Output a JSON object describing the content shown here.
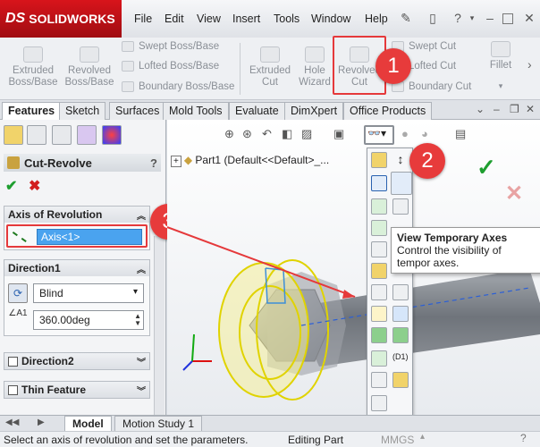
{
  "app": {
    "logo_ds": "DS",
    "logo_text": "SOLIDWORKS"
  },
  "menu": [
    "File",
    "Edit",
    "View",
    "Insert",
    "Tools",
    "Window",
    "Help"
  ],
  "ribbon": {
    "extruded_boss": "Extruded\nBoss/Base",
    "revolved_boss": "Revolved\nBoss/Base",
    "swept_boss": "Swept Boss/Base",
    "lofted_boss": "Lofted Boss/Base",
    "boundary_boss": "Boundary Boss/Base",
    "extruded_cut": "Extruded\nCut",
    "hole_wizard": "Hole\nWizard",
    "revolved_cut": "Revolved\nCut",
    "swept_cut": "Swept Cut",
    "lofted_cut": "Lofted Cut",
    "boundary_cut": "Boundary Cut",
    "fillet": "Fillet"
  },
  "tabs": [
    "Features",
    "Sketch",
    "Surfaces",
    "Mold Tools",
    "Evaluate",
    "DimXpert",
    "Office Products"
  ],
  "property_manager": {
    "title": "Cut-Revolve",
    "help": "?",
    "axis_group": "Axis of Revolution",
    "axis_value": "Axis<1>",
    "direction1": "Direction1",
    "type_value": "Blind",
    "angle_value": "360.00deg",
    "direction2": "Direction2",
    "thin_feature": "Thin Feature"
  },
  "viewport": {
    "tree_label": "Part1  (Default<<Default>_..."
  },
  "tooltip": {
    "title": "View Temporary Axes",
    "desc": "Control the visibility of tempor axes."
  },
  "palette": {
    "d1_label": "(D1)"
  },
  "bottom_tabs": [
    "Model",
    "Motion Study 1"
  ],
  "status": {
    "left": "Select an axis of revolution and set the parameters.",
    "middle": "Editing Part",
    "right": "MMGS"
  },
  "callouts": [
    "1",
    "2",
    "3"
  ],
  "colors": {
    "accent_red": "#e5393b",
    "brand_red": "#d8141b",
    "confirm_green": "#1e9e2f"
  }
}
